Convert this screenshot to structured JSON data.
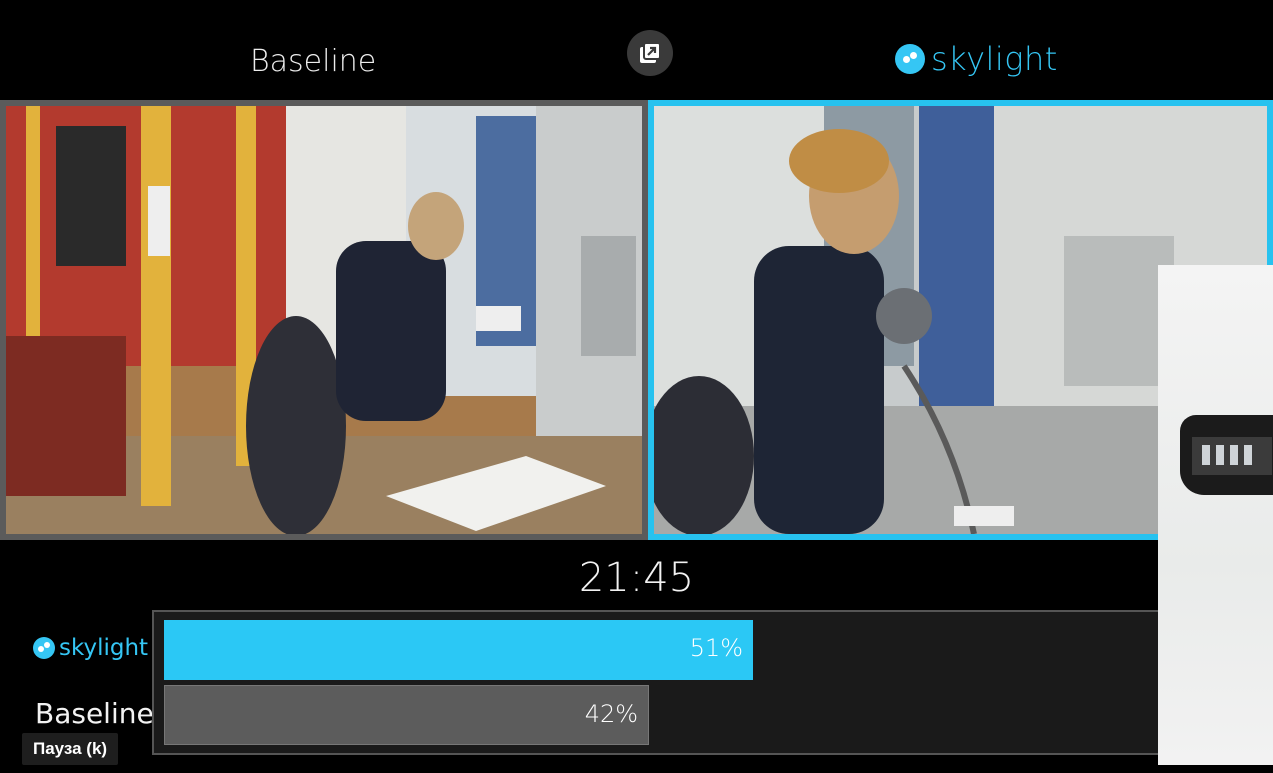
{
  "header": {
    "left_title": "Baseline",
    "popout_icon": "popout-icon",
    "right_brand": "skylight"
  },
  "timer": "21:45",
  "comparison": {
    "skylight": {
      "label": "skylight",
      "percent_text": "51%",
      "percent_value": 51
    },
    "baseline": {
      "label": "Baseline",
      "percent_text": "42%",
      "percent_value": 42
    },
    "accent_color": "#2bc8f5",
    "baseline_color": "#5c5c5c"
  },
  "tooltip": "Пауза (k)"
}
